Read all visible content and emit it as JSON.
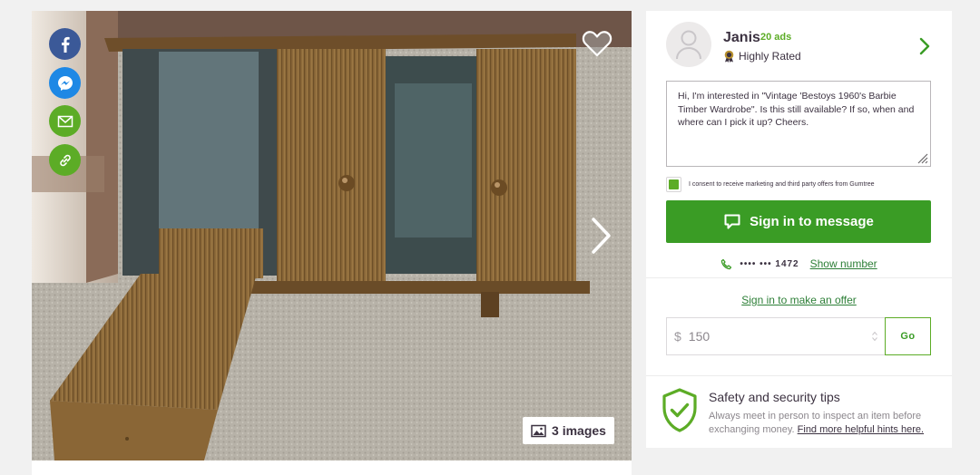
{
  "gallery": {
    "image_count_label": "3 images",
    "share_buttons": [
      {
        "name": "facebook-share-button",
        "color": "#3b5998",
        "icon": "facebook-icon"
      },
      {
        "name": "messenger-share-button",
        "color": "#1e88e5",
        "icon": "messenger-icon"
      },
      {
        "name": "email-share-button",
        "color": "#5cac26",
        "icon": "envelope-icon"
      },
      {
        "name": "copy-link-button",
        "color": "#5cac26",
        "icon": "link-icon"
      }
    ]
  },
  "seller": {
    "name": "Janis",
    "ads_count": "20 ads",
    "rating": "Highly Rated"
  },
  "message": {
    "text": "Hi, I'm interested in \"Vintage 'Bestoys 1960's Barbie Timber Wardrobe\". Is this still available? If so, when and where can I pick it up? Cheers."
  },
  "consent": {
    "label": "I consent to receive marketing and third party offers from Gumtree",
    "checked": true
  },
  "sign_in_button": {
    "label": "Sign in to message"
  },
  "phone": {
    "masked": "•••• ••• 1472",
    "show_label": "Show number"
  },
  "offer": {
    "link_label": "Sign in to make an offer",
    "currency": "$",
    "value": "150",
    "go_label": "Go"
  },
  "safety": {
    "title": "Safety and security tips",
    "text": "Always meet in person to inspect an item before exchanging money.",
    "link_label": "Find more helpful hints here."
  },
  "colors": {
    "brand_green": "#3a9c25",
    "accent_green": "#5cac26"
  }
}
